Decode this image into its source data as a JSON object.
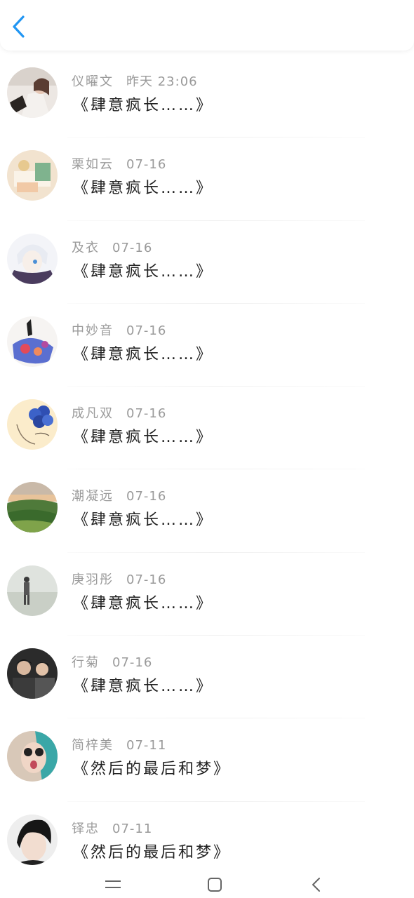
{
  "header": {
    "back_icon": "chevron-left-icon",
    "accent": "#2196f3"
  },
  "conversations": [
    {
      "name": "仪曜文",
      "time": "昨天 23:06",
      "message": "《肆意疯长……》",
      "avatar_icon": "girl-photo-avatar"
    },
    {
      "name": "栗如云",
      "time": "07-16",
      "message": "《肆意疯长……》",
      "avatar_icon": "still-life-avatar"
    },
    {
      "name": "及衣",
      "time": "07-16",
      "message": "《肆意疯长……》",
      "avatar_icon": "anime-boy-avatar"
    },
    {
      "name": "中妙音",
      "time": "07-16",
      "message": "《肆意疯长……》",
      "avatar_icon": "ethnic-art-avatar"
    },
    {
      "name": "成凡双",
      "time": "07-16",
      "message": "《肆意疯长……》",
      "avatar_icon": "blue-flower-avatar"
    },
    {
      "name": "潮凝远",
      "time": "07-16",
      "message": "《肆意疯长……》",
      "avatar_icon": "landscape-avatar"
    },
    {
      "name": "庚羽彤",
      "time": "07-16",
      "message": "《肆意疯长……》",
      "avatar_icon": "beach-person-avatar"
    },
    {
      "name": "行菊",
      "time": "07-16",
      "message": "《肆意疯长……》",
      "avatar_icon": "two-boys-avatar"
    },
    {
      "name": "简梓美",
      "time": "07-11",
      "message": "《然后的最后和梦》",
      "avatar_icon": "sunglasses-girl-avatar"
    },
    {
      "name": "铎忠",
      "time": "07-11",
      "message": "《然后的最后和梦》",
      "avatar_icon": "dark-hair-boy-avatar"
    }
  ],
  "navbar": {
    "menu_icon": "menu-icon",
    "home_icon": "home-icon",
    "back_icon": "back-icon"
  }
}
